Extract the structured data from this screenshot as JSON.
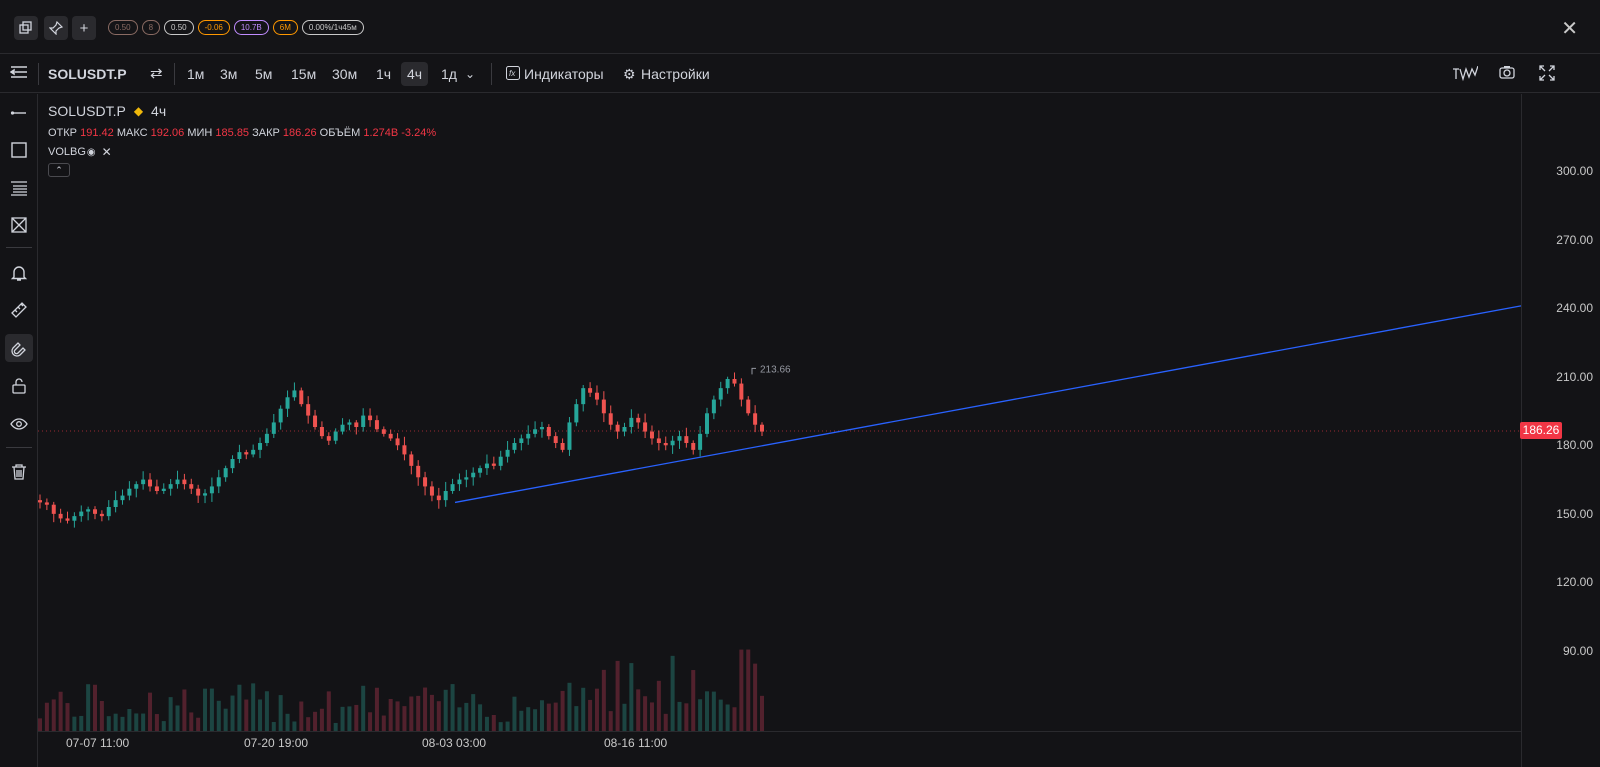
{
  "topbar": {
    "badges": [
      {
        "text": "0.50",
        "color": "#8a6b63"
      },
      {
        "text": "8",
        "color": "#8a6b63"
      },
      {
        "text": "0.50",
        "color": "#c9c9c9"
      },
      {
        "text": "-0.06",
        "color": "#ff9800"
      },
      {
        "text": "10.7B",
        "color": "#c08cff"
      },
      {
        "text": "6M",
        "color": "#ff9800"
      },
      {
        "text": "0.00%/1ч45м",
        "color": "#c9c9c9"
      }
    ],
    "close_glyph": "✕"
  },
  "toolbar": {
    "symbol": "SOLUSDT.P",
    "timeframes": [
      "1м",
      "3м",
      "5м",
      "15м",
      "30м",
      "1ч",
      "4ч",
      "1д"
    ],
    "active_timeframe": "4ч",
    "indicators_label": "Индикаторы",
    "settings_label": "Настройки"
  },
  "legend": {
    "symbol": "SOLUSDT.P",
    "interval": "4ч",
    "open_label": "ОТКР",
    "open": "191.42",
    "high_label": "МАКС",
    "high": "192.06",
    "low_label": "МИН",
    "low": "185.85",
    "close_label": "ЗАКР",
    "close": "186.26",
    "volume_label": "ОБЪЁМ",
    "volume": "1.274B",
    "change": "-3.24%",
    "indicator": "VOLBG"
  },
  "price_axis": [
    "300.00",
    "270.00",
    "240.00",
    "210.00",
    "180.00",
    "150.00",
    "120.00",
    "90.00"
  ],
  "current_price": "186.26",
  "time_axis": [
    "07-07 11:00",
    "07-20 19:00",
    "08-03 03:00",
    "08-16 11:00"
  ],
  "chart_data": {
    "type": "candlestick",
    "high_marker": "213.66",
    "colors": {
      "up": "#26a69a",
      "down": "#ef5350",
      "trendline": "#2962ff",
      "current_price": "#f23645"
    },
    "ylim": [
      60,
      330
    ],
    "trendline": {
      "from_price": 155,
      "to_price": 241
    },
    "closes": [
      155,
      154,
      150,
      148,
      147,
      149,
      151,
      152,
      150,
      149,
      153,
      156,
      158,
      161,
      163,
      165,
      162,
      160,
      161,
      163,
      165,
      163,
      161,
      158,
      159,
      162,
      166,
      170,
      174,
      177,
      176,
      178,
      181,
      185,
      190,
      196,
      201,
      204,
      198,
      193,
      188,
      184,
      182,
      186,
      189,
      190,
      188,
      193,
      191,
      187,
      185,
      183,
      180,
      176,
      171,
      166,
      162,
      158,
      156,
      160,
      163,
      165,
      166,
      168,
      170,
      172,
      171,
      175,
      178,
      181,
      183,
      185,
      187,
      188,
      184,
      181,
      178,
      190,
      198,
      205,
      203,
      200,
      194,
      189,
      186,
      188,
      192,
      190,
      186,
      183,
      181,
      180,
      182,
      184,
      181,
      178,
      185,
      194,
      200,
      205,
      209,
      207,
      200,
      194,
      189,
      186
    ]
  }
}
